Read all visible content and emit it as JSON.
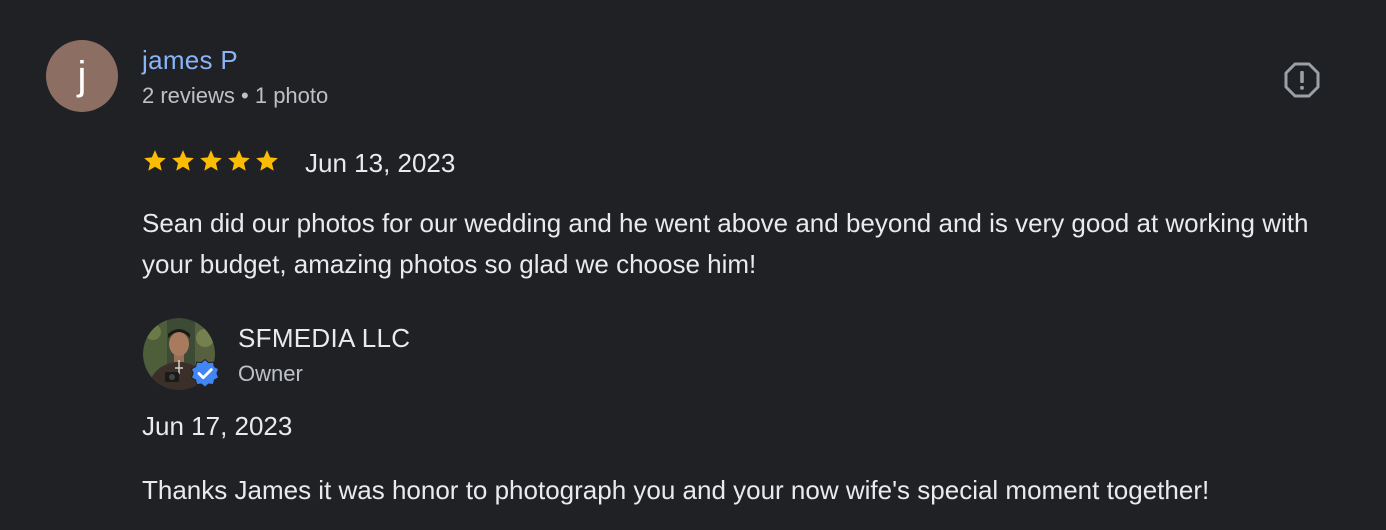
{
  "review": {
    "reviewer": {
      "initial": "j",
      "name": "james P",
      "meta": "2 reviews • 1 photo",
      "avatar_color": "#8d6e63",
      "name_color": "#8ab4f8"
    },
    "rating": 5,
    "star_color": "#fbbc04",
    "date": "Jun 13, 2023",
    "text": "Sean did our photos for our wedding and he went above and beyond and is very good at working with your budget, amazing photos so glad we choose him!",
    "report_icon": "report-icon"
  },
  "owner_reply": {
    "name": "SFMEDIA LLC",
    "role": "Owner",
    "verified_icon": "verified-badge-icon",
    "badge_color": "#4285f4",
    "date": "Jun 17, 2023",
    "text": "Thanks James it was honor to photograph you and your now wife's special moment together!"
  }
}
